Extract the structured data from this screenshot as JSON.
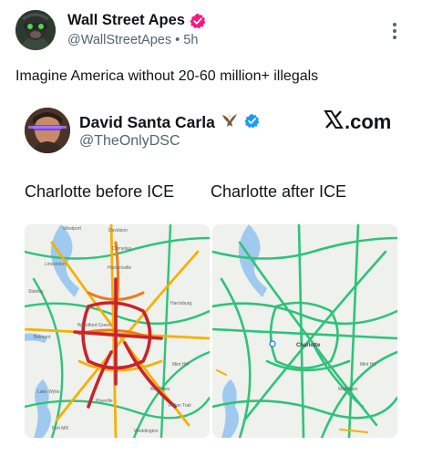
{
  "post": {
    "author_name": "Wall Street Apes",
    "author_handle": "@WallStreetApes",
    "separator": "•",
    "time": "5h",
    "text": "Imagine America without 20-60 million+ illegals"
  },
  "embedded": {
    "author_name": "David Santa Carla",
    "author_handle": "@TheOnlyDSC",
    "brand_suffix": ".com",
    "caption_before": "Charlotte before ICE",
    "caption_after": "Charlotte after ICE",
    "map_before_labels": [
      {
        "id": "l1",
        "text": "Westport"
      },
      {
        "id": "l2",
        "text": "Davidson"
      },
      {
        "id": "l3",
        "text": "Cornelius"
      },
      {
        "id": "l4",
        "text": "Lincolnton"
      },
      {
        "id": "l5",
        "text": "Huntersville"
      },
      {
        "id": "l6",
        "text": "Stanley"
      },
      {
        "id": "l7",
        "text": "Harrisburg"
      },
      {
        "id": "l8",
        "text": "Woodford Green"
      },
      {
        "id": "l9",
        "text": "Belmont"
      },
      {
        "id": "l10",
        "text": "Mint Hill"
      },
      {
        "id": "l11",
        "text": "Lake Wylie"
      },
      {
        "id": "l12",
        "text": "Matthews"
      },
      {
        "id": "l13",
        "text": "Pineville"
      },
      {
        "id": "l14",
        "text": "Indian Trail"
      },
      {
        "id": "l15",
        "text": "Fort Mill"
      },
      {
        "id": "l16",
        "text": "Weddington"
      }
    ],
    "map_after_labels": [
      {
        "id": "a1",
        "text": "Charlotte"
      },
      {
        "id": "a2",
        "text": "Mint Hill"
      },
      {
        "id": "a3",
        "text": "Matthews"
      }
    ]
  },
  "colors": {
    "verified": "#f91880",
    "blue_check": "#1d9bf0",
    "muted": "#536471",
    "traffic_green": "#2fc27a",
    "traffic_yellow": "#f6b000",
    "traffic_orange": "#f07a1a",
    "traffic_red": "#c9232d"
  },
  "icons": [
    "verified-badge-icon",
    "more-options-icon",
    "eagle-icon",
    "blue-check-icon",
    "x-logo-icon"
  ]
}
